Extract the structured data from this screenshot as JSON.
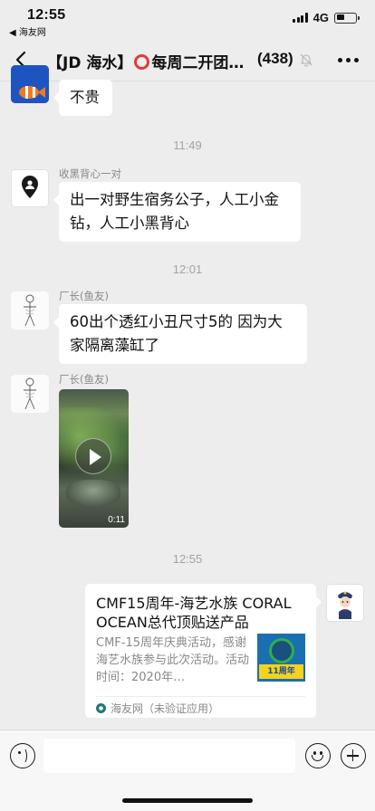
{
  "status_bar": {
    "time": "12:55",
    "back_app": "◀ 海友网",
    "network": "4G",
    "battery_level": 0.45
  },
  "nav": {
    "title_prefix": "【JD 海水】",
    "title_suffix": "每周二开团…",
    "member_count": "(438)"
  },
  "messages": [
    {
      "type": "text",
      "direction": "incoming",
      "sender": "",
      "text": "不贵",
      "avatar": "clownfish-avatar"
    },
    {
      "type": "timestamp",
      "text": "11:49"
    },
    {
      "type": "text",
      "direction": "incoming",
      "sender": "收黑背心一对",
      "text": "出一对野生宿务公子，人工小金钻，人工小黑背心",
      "avatar": "location-pin-avatar"
    },
    {
      "type": "timestamp",
      "text": "12:01"
    },
    {
      "type": "text",
      "direction": "incoming",
      "sender": "厂长(鱼友)",
      "text": "60出个透红小丑尺寸5的 因为大家隔离藻缸了",
      "avatar": "sketch-figure-avatar"
    },
    {
      "type": "video",
      "direction": "incoming",
      "sender": "厂长(鱼友)",
      "duration": "0:11",
      "avatar": "sketch-figure-avatar"
    },
    {
      "type": "timestamp",
      "text": "12:55"
    },
    {
      "type": "link_card",
      "direction": "outgoing",
      "title": "CMF15周年-海艺水族 CORAL OCEAN总代顶贴送产品",
      "description": "CMF-15周年庆典活动，感谢海艺水族参与此次活动。活动时间：2020年…",
      "thumbnail_text": "11周年",
      "source": "海友网（未验证应用）",
      "avatar": "cartoon-officer-avatar"
    }
  ],
  "input_bar": {
    "placeholder": ""
  },
  "colors": {
    "chat_background": "#ededed",
    "bubble_incoming": "#ffffff",
    "timestamp_text": "#a3a3a3",
    "title_ring": "#e03a3a"
  }
}
